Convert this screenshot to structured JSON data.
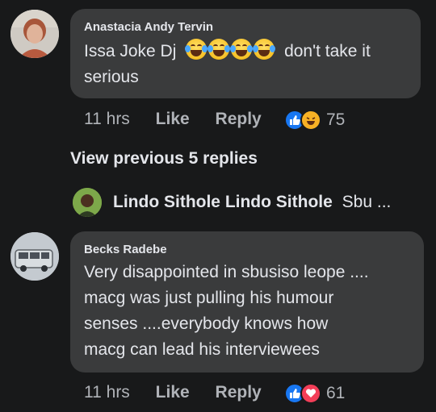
{
  "comment1": {
    "author": "Anastacia Andy Tervin",
    "text_before": "Issa Joke Dj",
    "emojis": [
      "laughing-tears-emoji",
      "laughing-tears-emoji",
      "laughing-tears-emoji",
      "laughing-tears-emoji"
    ],
    "text_after": "don't take it",
    "text_line2": "serious",
    "time": "11 hrs",
    "like_label": "Like",
    "reply_label": "Reply",
    "reaction_count": "75",
    "reaction_icons": [
      "like-icon",
      "haha-icon"
    ]
  },
  "view_previous": "View previous 5 replies",
  "reply_preview": {
    "author": "Lindo Sithole Lindo Sithole",
    "snippet": "Sbu ..."
  },
  "comment2": {
    "author": "Becks Radebe",
    "lines": [
      "Very disappointed in sbusiso leope ....",
      "macg was just pulling his humour",
      "senses ....everybody knows how",
      "macg can lead his interviewees"
    ],
    "time": "11 hrs",
    "like_label": "Like",
    "reply_label": "Reply",
    "reaction_count": "61",
    "reaction_icons": [
      "like-icon",
      "love-icon"
    ]
  },
  "colors": {
    "background": "#18191a",
    "bubble": "#3a3b3c",
    "text": "#e4e6eb",
    "meta": "#b0b3b8",
    "like_blue": "#1877f2",
    "love_red": "#f33e58"
  }
}
